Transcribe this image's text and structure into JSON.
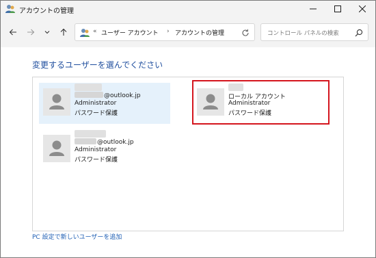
{
  "window": {
    "title": "アカウントの管理"
  },
  "nav": {
    "breadcrumb_more": "«",
    "breadcrumb": [
      "ユーザー アカウント",
      "アカウントの管理"
    ],
    "breadcrumb_separator": "›",
    "search_placeholder": "コントロール パネルの検索"
  },
  "main": {
    "heading": "変更するユーザーを選んでください",
    "users": [
      {
        "email_domain": "@outlook.jp",
        "role": "Administrator",
        "protection": "パスワード保護",
        "selected": true
      },
      {
        "account_type": "ローカル アカウント",
        "role": "Administrator",
        "protection": "パスワード保護",
        "highlighted": true
      },
      {
        "email_domain": "@outlook.jp",
        "role": "Administrator",
        "protection": "パスワード保護"
      }
    ],
    "add_user_link": "PC 設定で新しいユーザーを追加"
  },
  "colors": {
    "heading": "#1f4e9e",
    "link": "#1f5fb4",
    "selected_card": "#e5f1fb",
    "highlight_border": "#d4141c"
  },
  "icons": [
    "users-app-icon",
    "minimize-icon",
    "maximize-icon",
    "close-icon",
    "back-arrow-icon",
    "forward-arrow-icon",
    "chevron-down-icon",
    "up-arrow-icon",
    "refresh-icon",
    "search-icon",
    "user-avatar-icon"
  ]
}
